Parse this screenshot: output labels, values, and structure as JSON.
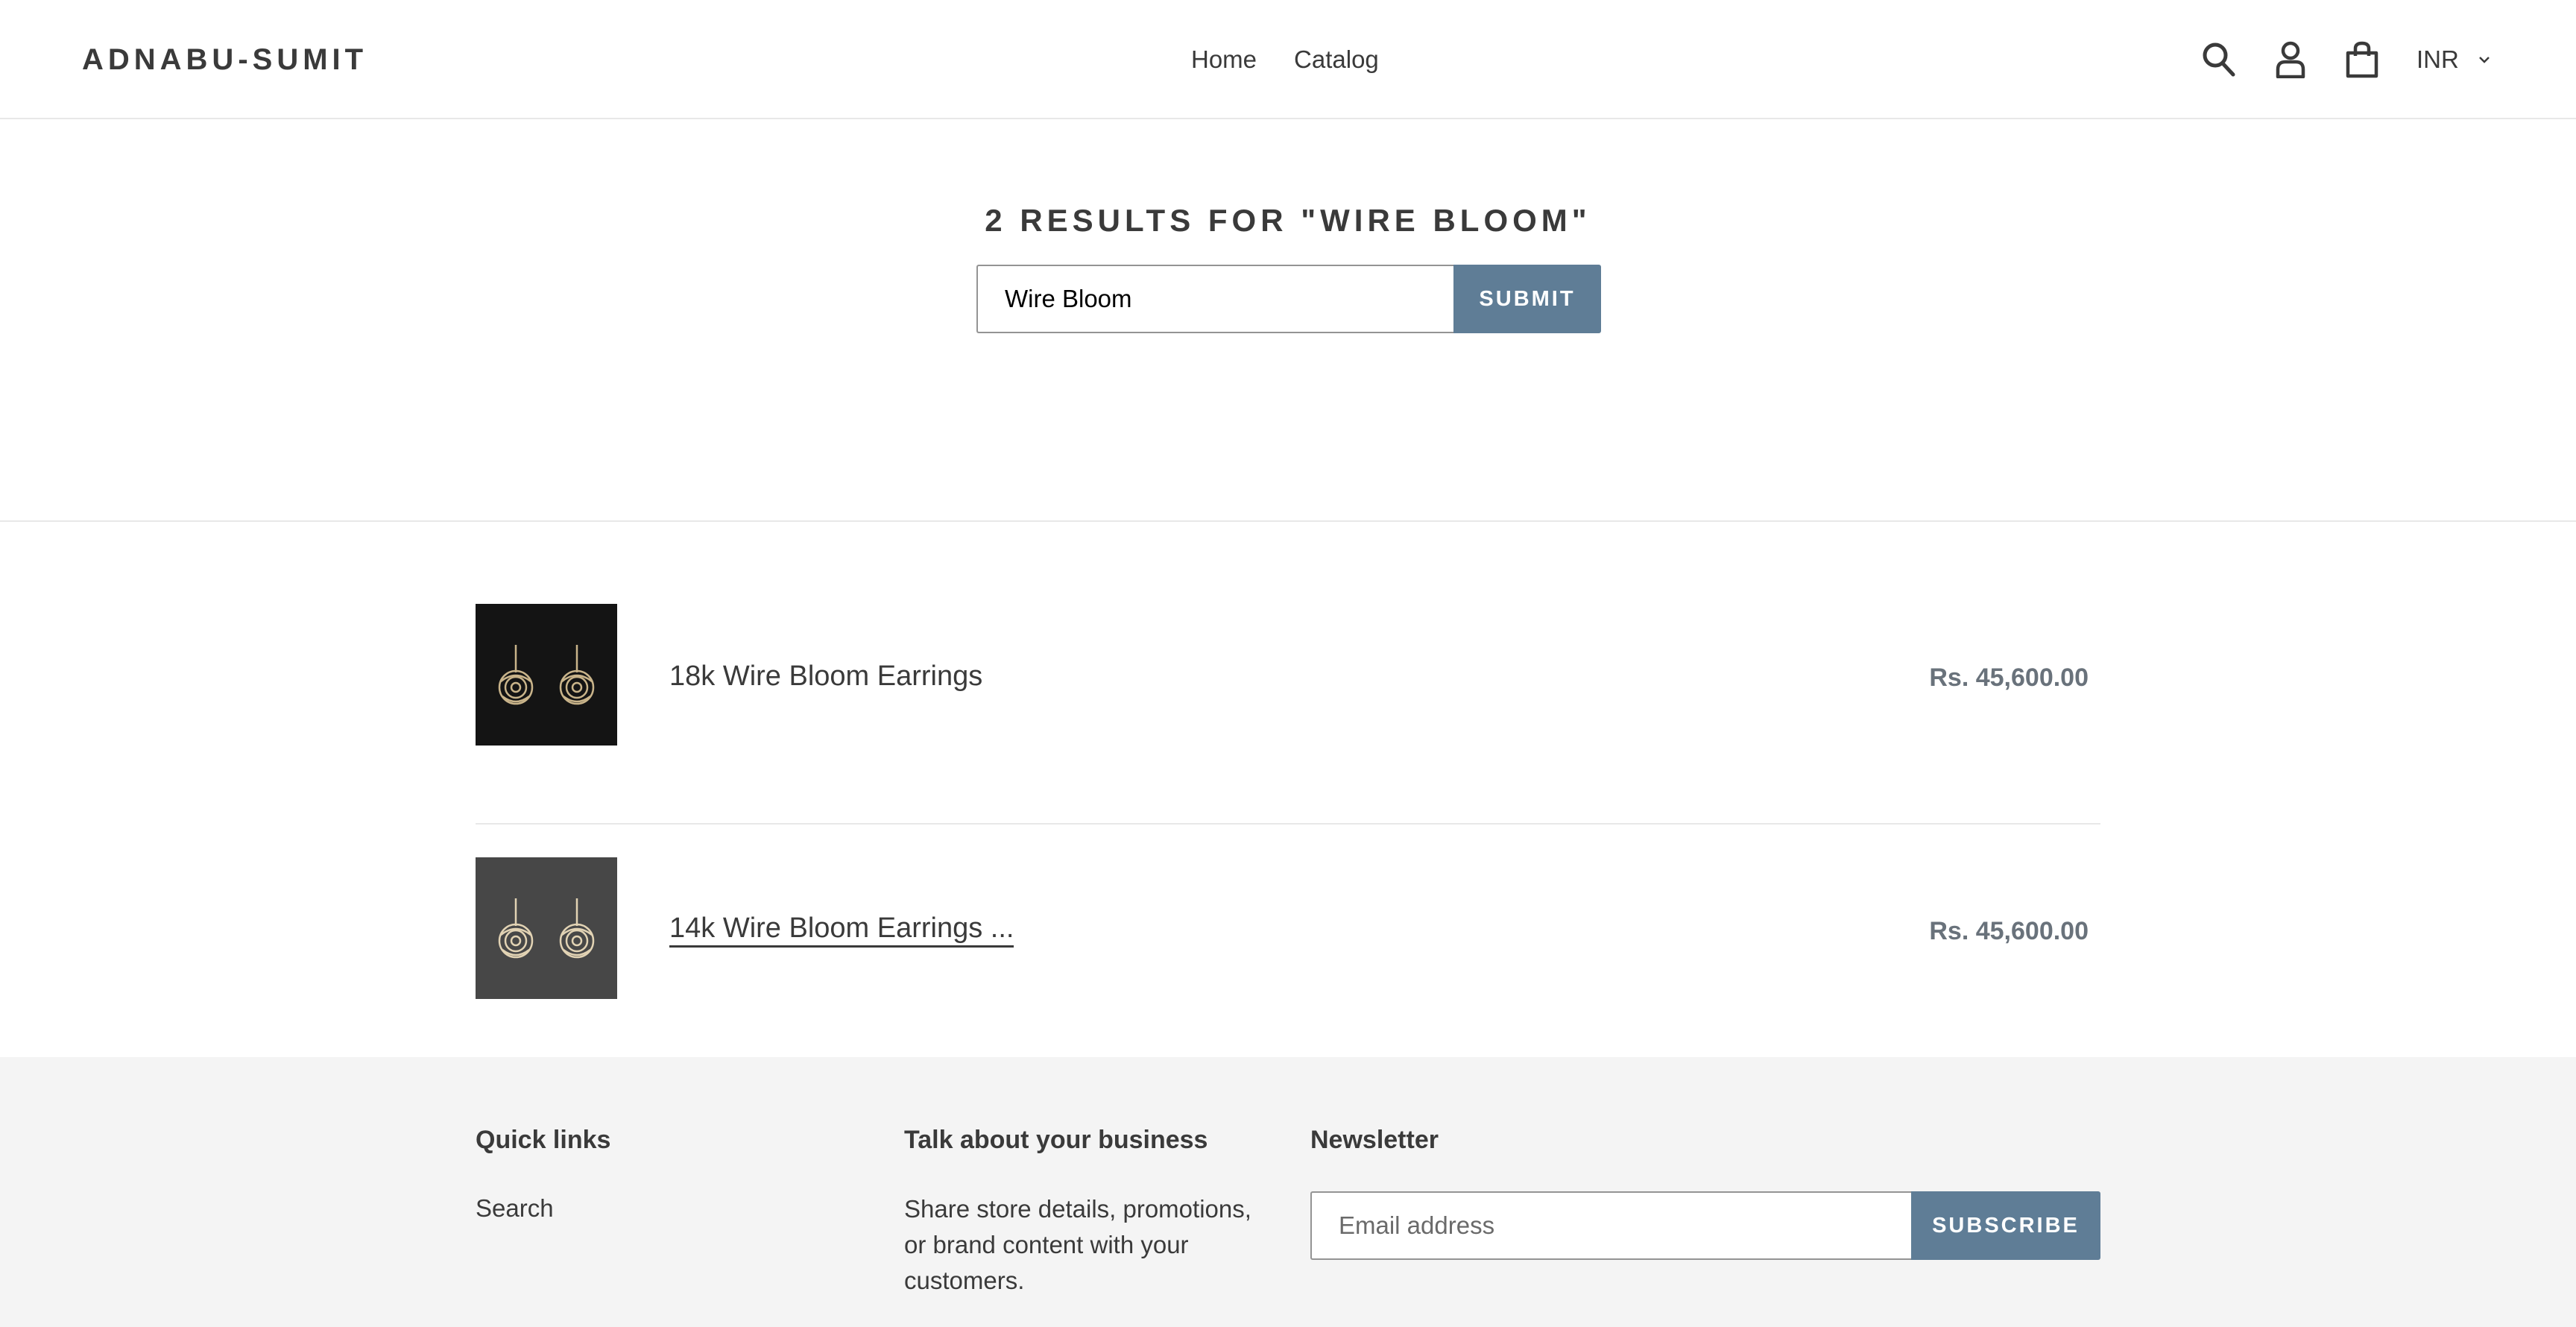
{
  "header": {
    "logo": "ADNABU-SUMIT",
    "nav": [
      {
        "label": "Home"
      },
      {
        "label": "Catalog"
      }
    ],
    "icons": [
      "search-icon",
      "account-icon",
      "cart-icon"
    ],
    "currency": "INR"
  },
  "search": {
    "title": "2 results for \"Wire Bloom\"",
    "query": "Wire Bloom",
    "submit_label": "Submit"
  },
  "results": [
    {
      "name": "18k Wire Bloom Earrings",
      "price": "Rs. 45,600.00",
      "thumb_color": "#141414"
    },
    {
      "name": "14k Wire Bloom Earrings ...",
      "price": "Rs. 45,600.00",
      "thumb_color": "#474747"
    }
  ],
  "footer": {
    "quick_links": {
      "heading": "Quick links",
      "links": [
        "Search"
      ]
    },
    "business": {
      "heading": "Talk about your business",
      "text": "Share store details, promotions, or brand content with your customers."
    },
    "newsletter": {
      "heading": "Newsletter",
      "placeholder": "Email address",
      "subscribe_label": "Subscribe"
    }
  },
  "colors": {
    "accent": "#5f7d96",
    "text": "#3a3a3a",
    "price": "#69727b",
    "footer_bg": "#f4f4f4"
  }
}
